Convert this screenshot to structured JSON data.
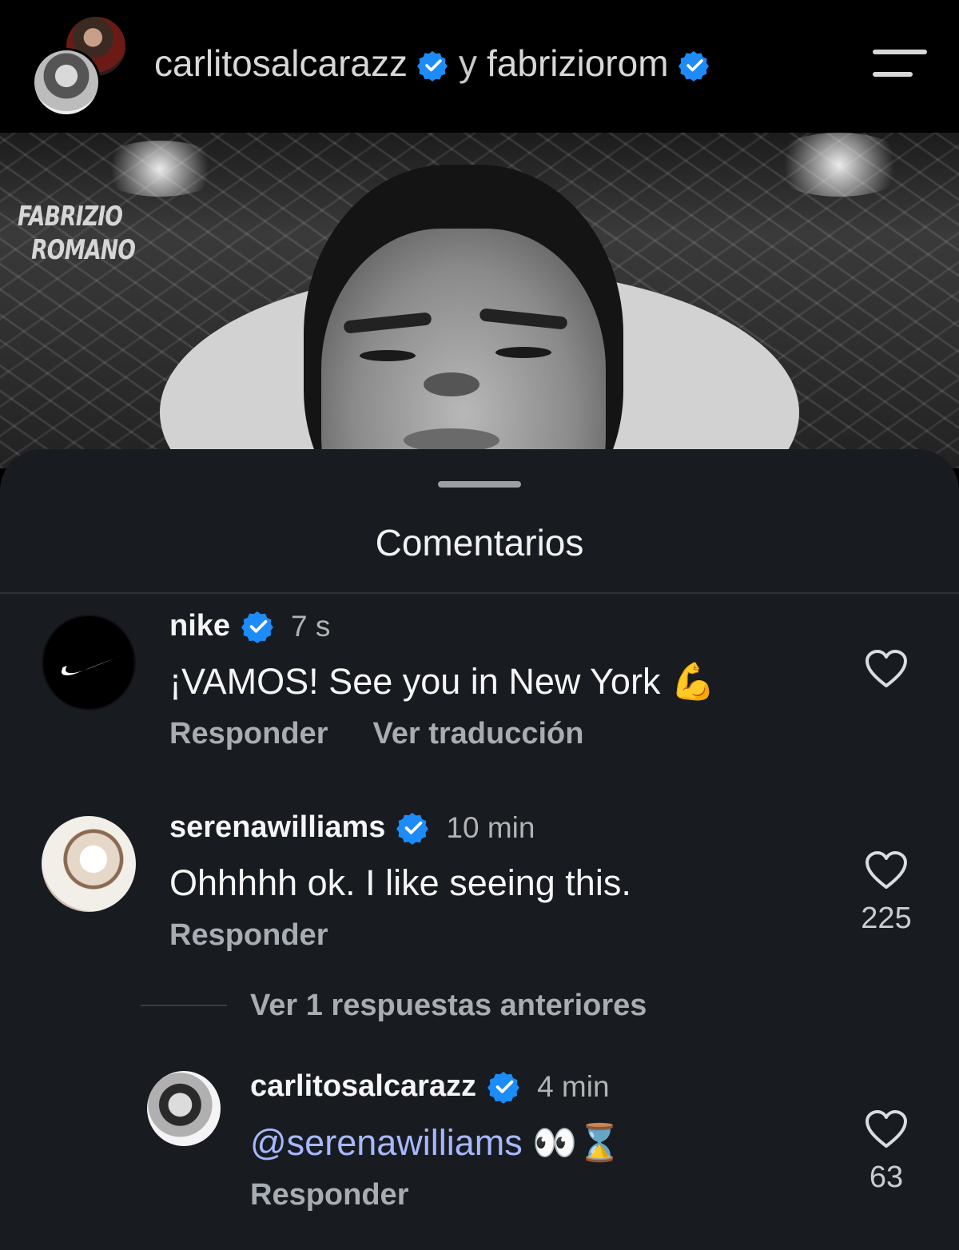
{
  "header": {
    "user1": "carlitosalcarazz",
    "connector": "y",
    "user2": "fabriziorom",
    "icons": {
      "menu": "menu-icon",
      "verified": "verified-badge-icon"
    }
  },
  "hero": {
    "watermark_line1": "FABRIZIO",
    "watermark_line2": "ROMANO"
  },
  "comments_sheet": {
    "title": "Comentarios",
    "comments": [
      {
        "username": "nike",
        "time": "7 s",
        "text": "¡VAMOS! See you in New York 💪",
        "actions": [
          "Responder",
          "Ver traducción"
        ],
        "likes": ""
      },
      {
        "username": "serenawilliams",
        "time": "10 min",
        "text": "Ohhhhh ok. I like seeing this.",
        "actions": [
          "Responder"
        ],
        "likes": "225"
      }
    ],
    "view_replies": "Ver 1 respuestas anteriores",
    "reply": {
      "username": "carlitosalcarazz",
      "time": "4 min",
      "mention": "@serenawilliams",
      "text_after": "👀⌛",
      "action": "Responder",
      "likes": "63"
    }
  },
  "colors": {
    "background": "#000000",
    "sheet": "#181c21",
    "verified": "#1d8cf8",
    "mention": "#a7b8ff"
  }
}
